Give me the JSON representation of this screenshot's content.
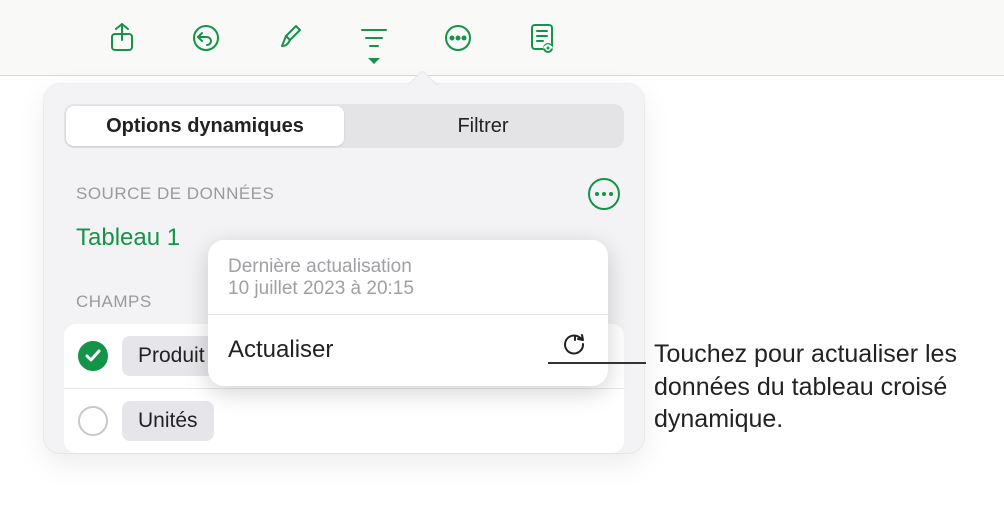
{
  "toolbar": {
    "icons": [
      "share",
      "undo",
      "format",
      "organize",
      "more",
      "reading"
    ]
  },
  "tabs": {
    "pivot": "Options dynamiques",
    "filter": "Filtrer"
  },
  "source": {
    "section_title": "SOURCE DE DONNÉES",
    "name": "Tableau 1"
  },
  "fields": {
    "section_title": "CHAMPS",
    "items": [
      {
        "label": "Produit",
        "checked": true
      },
      {
        "label": "Unités",
        "checked": false
      }
    ]
  },
  "refresh": {
    "last_label": "Dernière actualisation",
    "timestamp": "10 juillet 2023 à 20:15",
    "action": "Actualiser"
  },
  "callout": {
    "text": "Touchez pour actualiser les données du tableau croisé dynamique."
  },
  "colors": {
    "accent": "#149448"
  }
}
